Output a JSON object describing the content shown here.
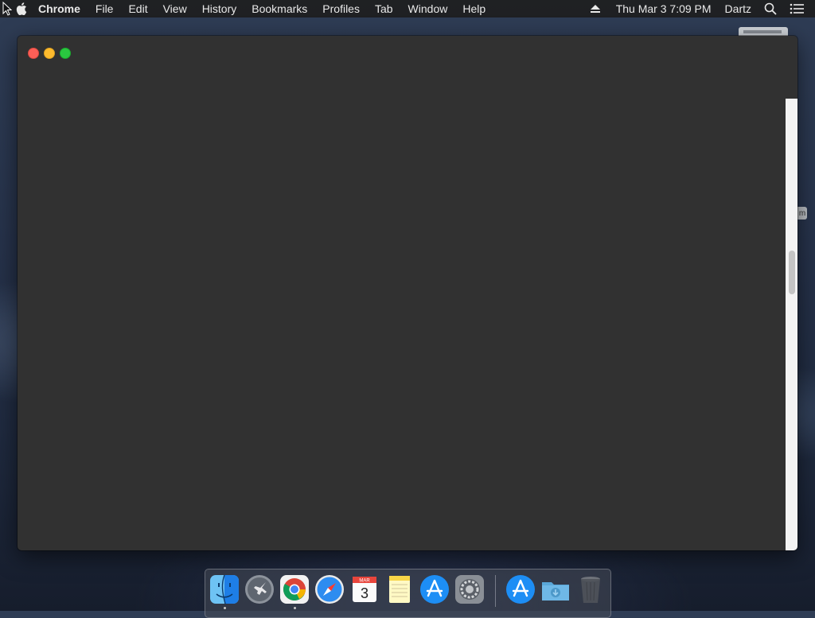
{
  "menubar": {
    "app_name": "Chrome",
    "menus": [
      "File",
      "Edit",
      "View",
      "History",
      "Bookmarks",
      "Profiles",
      "Tab",
      "Window",
      "Help"
    ],
    "clock": "Thu Mar 3  7:09 PM",
    "user": "Dartz"
  },
  "background_window": {
    "tab_glyph": "m"
  },
  "window": {
    "controls": [
      "close",
      "minimize",
      "maximize"
    ],
    "colors": {
      "close": "#fc5f57",
      "minimize": "#fdbb2e",
      "maximize": "#2ac840",
      "body": "#313131"
    }
  },
  "dock": {
    "apps": [
      {
        "name": "Finder",
        "icon": "finder-icon",
        "running": true
      },
      {
        "name": "Launchpad",
        "icon": "launchpad-icon",
        "running": false
      },
      {
        "name": "Google Chrome",
        "icon": "chrome-icon",
        "running": true
      },
      {
        "name": "Safari",
        "icon": "safari-icon",
        "running": false
      },
      {
        "name": "Calendar",
        "icon": "calendar-icon",
        "running": false,
        "month": "MAR",
        "day": "3"
      },
      {
        "name": "Notes",
        "icon": "notes-icon",
        "running": false
      },
      {
        "name": "App Store",
        "icon": "app-store-icon",
        "running": false
      },
      {
        "name": "System Preferences",
        "icon": "system-preferences-icon",
        "running": false
      },
      {
        "name": "App Store Downloads",
        "icon": "app-store-icon",
        "running": false
      },
      {
        "name": "Downloads",
        "icon": "downloads-folder-icon",
        "running": false
      },
      {
        "name": "Trash",
        "icon": "trash-icon",
        "running": false
      }
    ]
  }
}
